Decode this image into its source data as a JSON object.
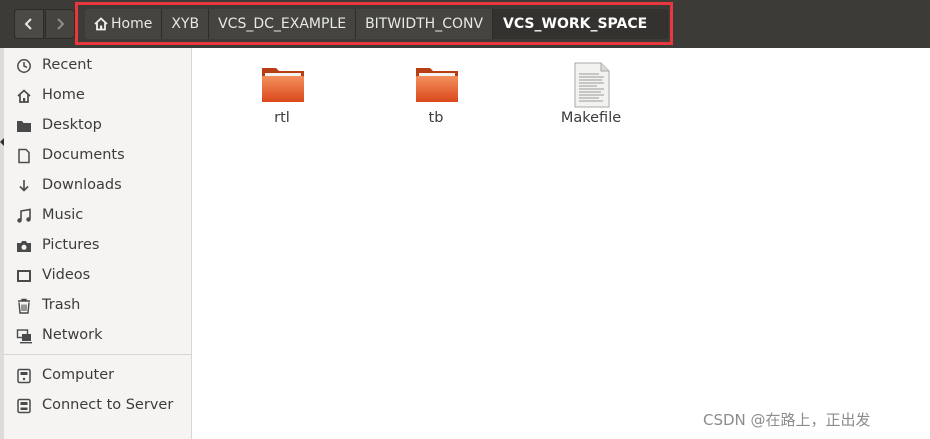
{
  "toolbar": {
    "back_icon": "chevron-left-icon",
    "forward_icon": "chevron-right-icon"
  },
  "breadcrumbs": [
    {
      "label": "Home",
      "icon": "home-icon"
    },
    {
      "label": "XYB"
    },
    {
      "label": "VCS_DC_EXAMPLE"
    },
    {
      "label": "BITWIDTH_CONV"
    },
    {
      "label": "VCS_WORK_SPACE"
    }
  ],
  "highlight_color": "#e8383d",
  "sidebar": {
    "items": [
      {
        "label": "Recent",
        "icon": "clock-icon"
      },
      {
        "label": "Home",
        "icon": "home-icon"
      },
      {
        "label": "Desktop",
        "icon": "folder-icon"
      },
      {
        "label": "Documents",
        "icon": "document-icon"
      },
      {
        "label": "Downloads",
        "icon": "download-icon"
      },
      {
        "label": "Music",
        "icon": "music-icon"
      },
      {
        "label": "Pictures",
        "icon": "camera-icon"
      },
      {
        "label": "Videos",
        "icon": "video-icon"
      },
      {
        "label": "Trash",
        "icon": "trash-icon"
      },
      {
        "label": "Network",
        "icon": "network-icon"
      },
      {
        "label": "Computer",
        "icon": "computer-icon"
      },
      {
        "label": "Connect to Server",
        "icon": "server-icon"
      }
    ]
  },
  "files": [
    {
      "name": "rtl",
      "type": "folder",
      "icon": "folder-icon"
    },
    {
      "name": "tb",
      "type": "folder",
      "icon": "folder-icon"
    },
    {
      "name": "Makefile",
      "type": "file",
      "icon": "text-file-icon"
    }
  ],
  "watermark": "CSDN @在路上，正出发",
  "colors": {
    "header_bg": "#3c3b37",
    "folder_orange": "#e95420",
    "sidebar_bg": "#f5f4f2"
  }
}
